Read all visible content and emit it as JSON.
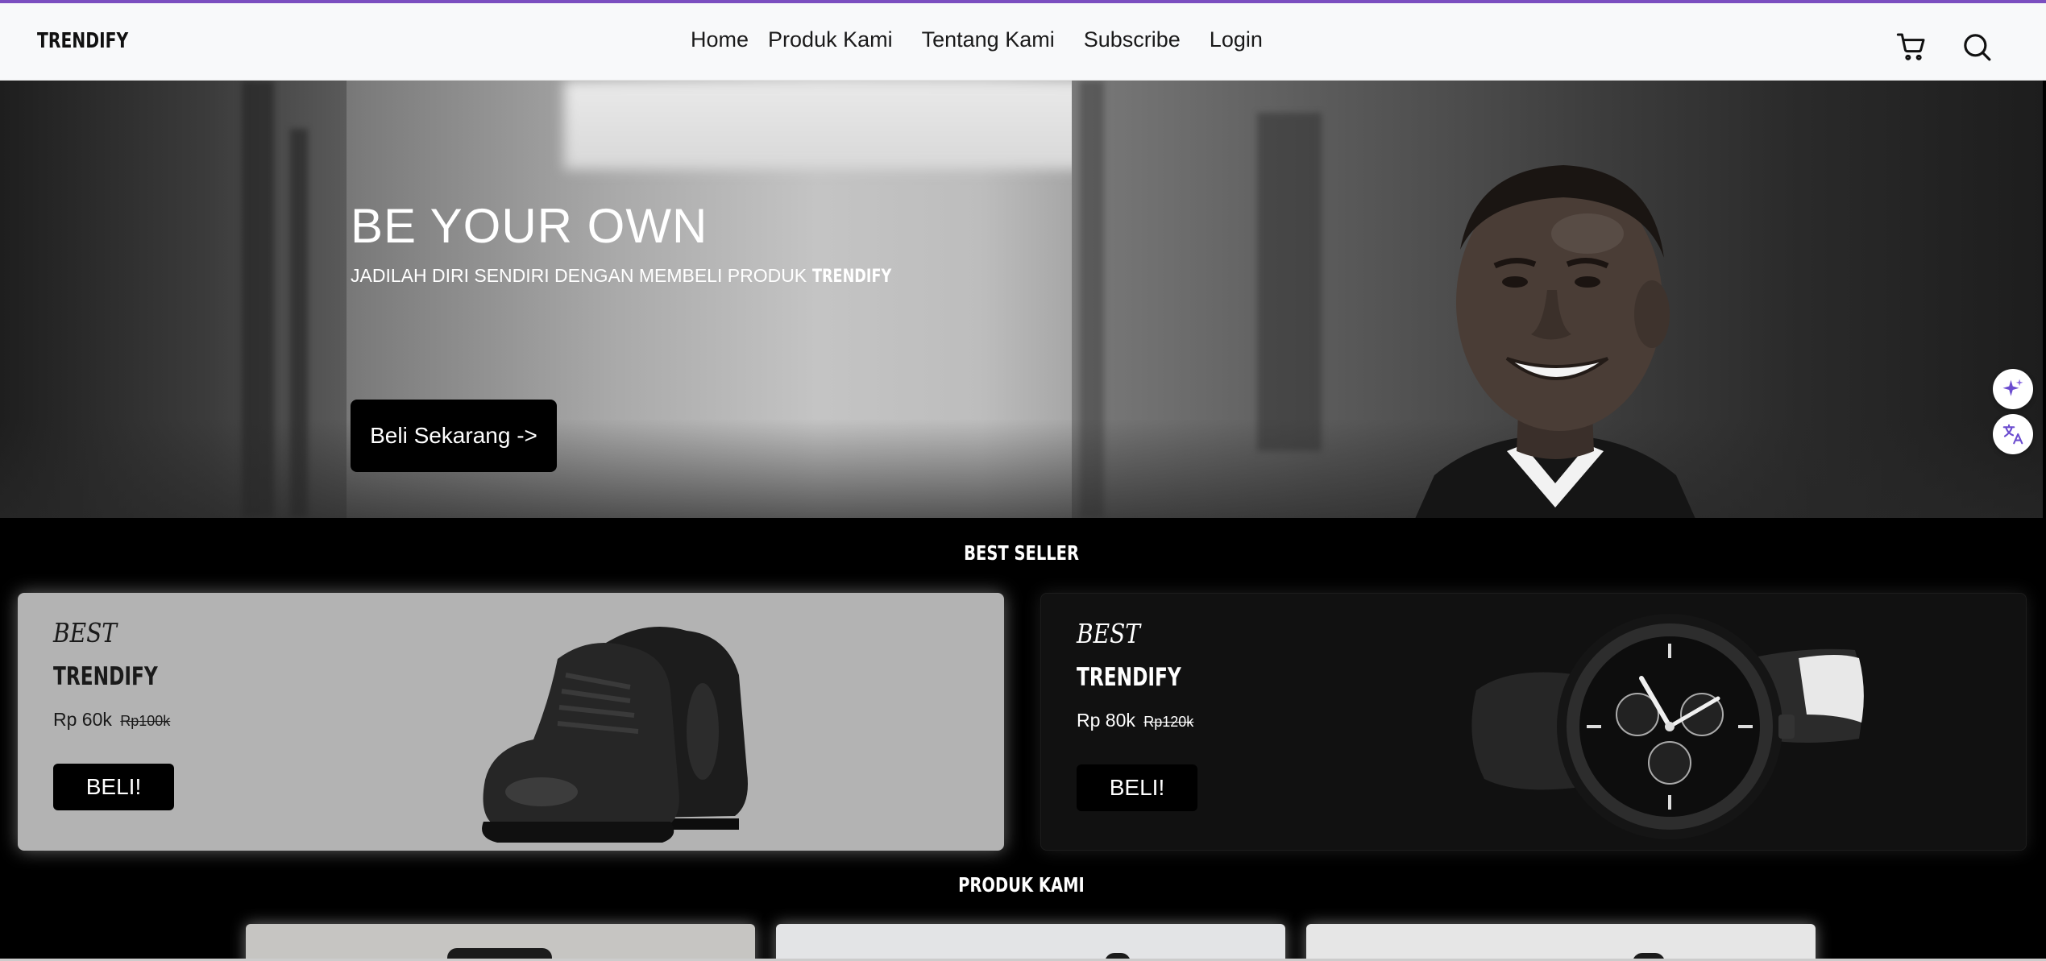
{
  "navbar": {
    "brand": "TRENDIFY",
    "links": [
      "Home",
      "Produk Kami",
      "Tentang Kami",
      "Subscribe",
      "Login"
    ],
    "icons": [
      "cart-icon",
      "search-icon"
    ]
  },
  "hero": {
    "title": "BE YOUR OWN",
    "subtitle": "JADILAH DIRI SENDIRI DENGAN MEMBELI PRODUK",
    "subtitle_brand": "TRENDIFY",
    "cta": "Beli Sekarang ->"
  },
  "floating": {
    "icons": [
      "sparkle-icon",
      "translate-icon"
    ],
    "accent": "#6b4ccf"
  },
  "best_seller": {
    "title": "BEST SELLER",
    "cards": [
      {
        "label": "BEST",
        "brand": "TRENDIFY",
        "price": "Rp 60k",
        "old_price": "Rp100k",
        "button": "BELI!",
        "product": "black sneakers"
      },
      {
        "label": "BEST",
        "brand": "TRENDIFY",
        "price": "Rp 80k",
        "old_price": "Rp120k",
        "button": "BELI!",
        "product": "black chronograph watch"
      }
    ]
  },
  "produk_kami": {
    "title": "PRODUK KAMI"
  },
  "colors": {
    "accent_top_bar": "#7b4fc0",
    "navbar_bg": "#f8f9fa",
    "page_bg": "#000000",
    "card_light": "#b3b3b3",
    "card_dark": "#111111"
  }
}
